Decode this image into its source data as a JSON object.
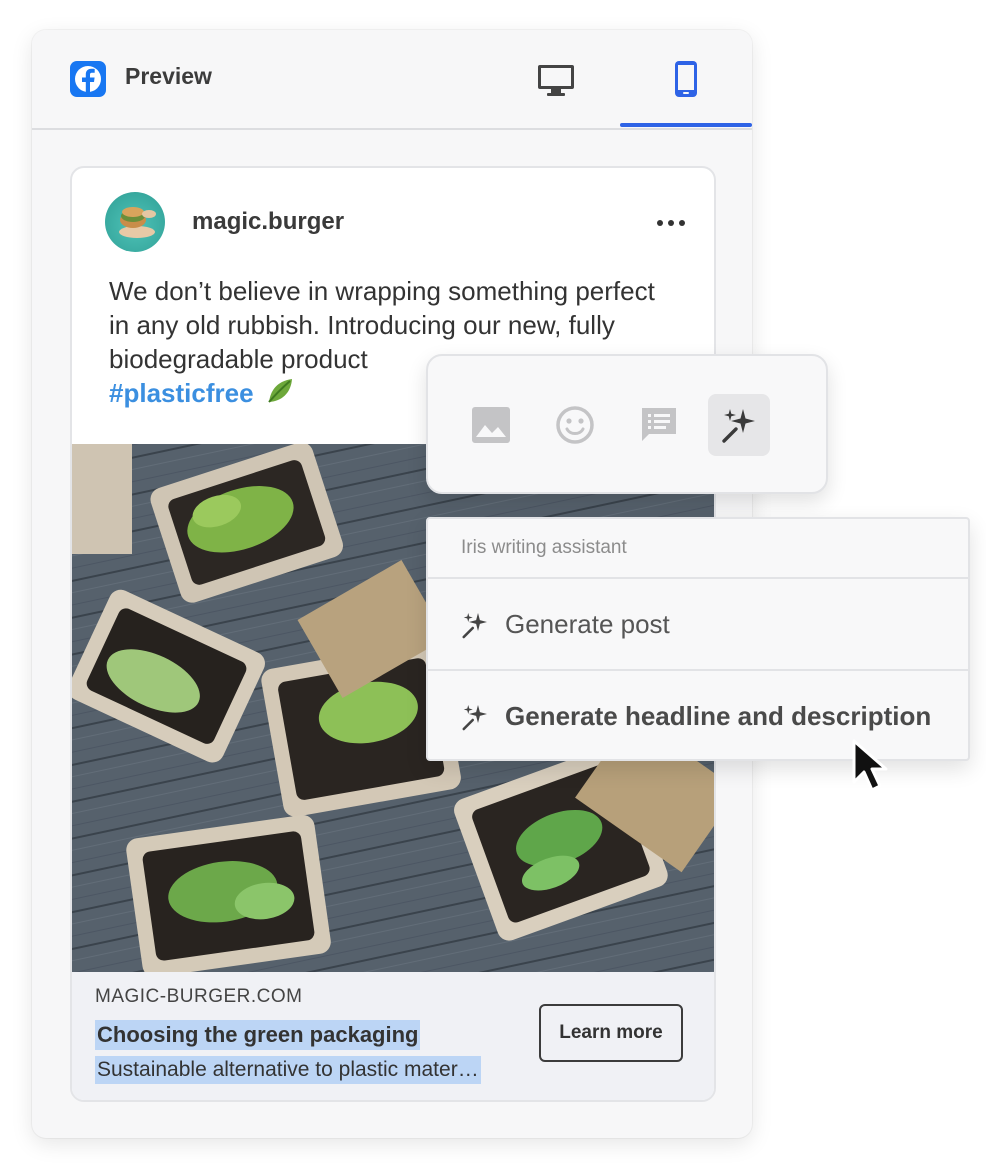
{
  "panel": {
    "title": "Preview",
    "tabs": [
      {
        "name": "desktop",
        "icon": "desktop-icon",
        "active": false
      },
      {
        "name": "mobile",
        "icon": "mobile-icon",
        "active": true
      }
    ],
    "accent_color": "#2e63e6",
    "brand_color": "#1877f2"
  },
  "post": {
    "author": "magic.burger",
    "text": "We don’t believe in wrapping something perfect in any old rubbish. Introducing our new, fully biodegradable product ",
    "hashtag": "#plasticfree",
    "link": {
      "domain": "MAGIC-BURGER.COM",
      "headline": "Choosing the green packaging",
      "description": "Sustainable alternative to plastic mater…",
      "cta": "Learn more"
    }
  },
  "toolbar": {
    "buttons": [
      {
        "icon": "image-icon",
        "active": false
      },
      {
        "icon": "emoji-icon",
        "active": false
      },
      {
        "icon": "text-snippet-icon",
        "active": false
      },
      {
        "icon": "sparkles-icon",
        "active": true
      }
    ]
  },
  "assistant_menu": {
    "header": "Iris writing assistant",
    "items": [
      {
        "label": "Generate post",
        "icon": "sparkles-icon",
        "hovered": false
      },
      {
        "label": "Generate headline and description",
        "icon": "sparkles-icon",
        "hovered": true
      }
    ]
  }
}
